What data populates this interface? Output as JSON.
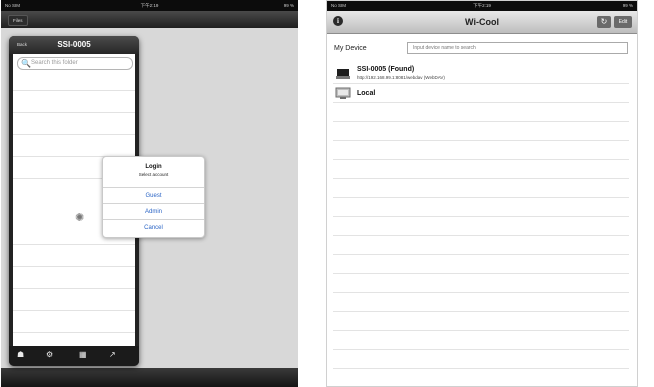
{
  "left": {
    "status": {
      "carrier": "No SIM",
      "time": "下午2:19",
      "battery": "99 %"
    },
    "topbar": {
      "button": "Files"
    },
    "popover": {
      "back": "Back",
      "title": "SSI-0005",
      "search_placeholder": "Search this folder"
    },
    "dialog": {
      "title": "Login",
      "subtitle": "Select account",
      "options": [
        "Guest",
        "Admin",
        "Cancel"
      ]
    }
  },
  "right": {
    "status": {
      "carrier": "No SIM",
      "time": "下午2:19",
      "battery": "99 %"
    },
    "nav": {
      "title": "Wi-Cool",
      "edit": "Edit"
    },
    "my_device_label": "My Device",
    "search_placeholder": "Input device name to search",
    "devices": [
      {
        "name": "SSI-0005 (Found)",
        "url": "http://192.168.99.1:8081/webdav (WebDAV)",
        "icon": "nas-drive-icon"
      },
      {
        "name": "Local",
        "url": "",
        "icon": "computer-monitor-icon"
      }
    ]
  }
}
